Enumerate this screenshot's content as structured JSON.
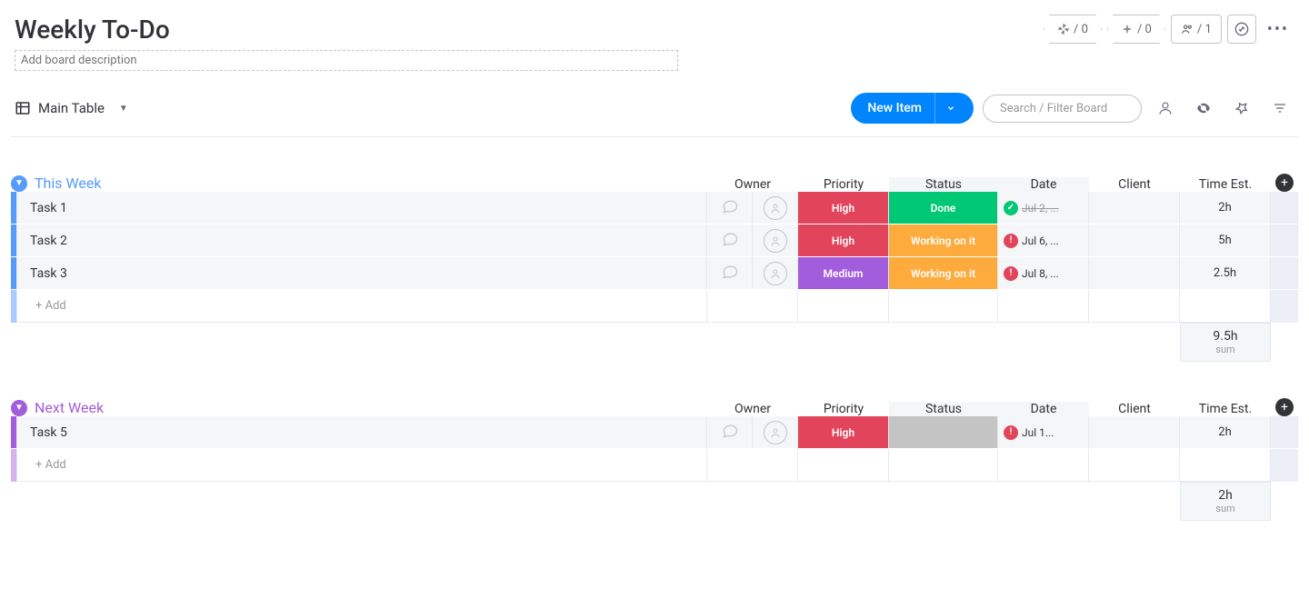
{
  "title": "Weekly To-Do",
  "desc_placeholder": "Add board description",
  "pills": {
    "automations": "/ 0",
    "integrations": "/ 0",
    "members": "/ 1"
  },
  "view": "Main Table",
  "new_item": "New Item",
  "search_placeholder": "Search / Filter Board",
  "cols": {
    "owner": "Owner",
    "priority": "Priority",
    "status": "Status",
    "date": "Date",
    "client": "Client",
    "time": "Time Est."
  },
  "add_row": "+ Add",
  "sum_label": "sum",
  "groups": [
    {
      "name": "This Week",
      "class": "g-blue",
      "rows": [
        {
          "name": "Task 1",
          "priority": "High",
          "pclass": "p-high",
          "status": "Done",
          "sclass": "s-done",
          "date": "Jul 2, ...",
          "dateok": true,
          "strike": true,
          "time": "2h"
        },
        {
          "name": "Task 2",
          "priority": "High",
          "pclass": "p-high",
          "status": "Working on it",
          "sclass": "s-working",
          "date": "Jul 6, ...",
          "dateok": false,
          "strike": false,
          "time": "5h"
        },
        {
          "name": "Task 3",
          "priority": "Medium",
          "pclass": "p-medium",
          "status": "Working on it",
          "sclass": "s-working",
          "date": "Jul 8, ...",
          "dateok": false,
          "strike": false,
          "time": "2.5h"
        }
      ],
      "sum": "9.5h"
    },
    {
      "name": "Next Week",
      "class": "g-purple",
      "rows": [
        {
          "name": "Task 5",
          "priority": "High",
          "pclass": "p-high",
          "status": "",
          "sclass": "s-empty",
          "date": "Jul 1...",
          "dateok": false,
          "strike": false,
          "time": "2h"
        }
      ],
      "sum": "2h"
    }
  ]
}
